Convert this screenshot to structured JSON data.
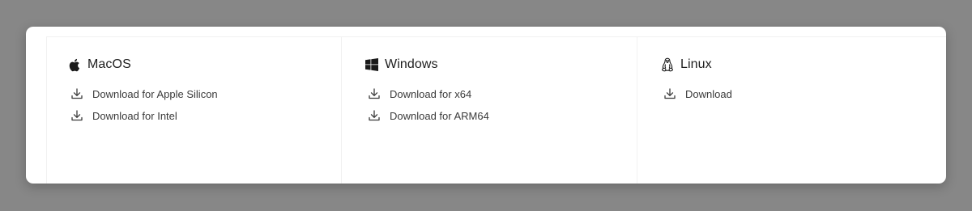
{
  "platforms": [
    {
      "name": "MacOS",
      "icon": "apple-logo-icon",
      "links": [
        {
          "label": "Download for Apple Silicon",
          "icon": "download-icon"
        },
        {
          "label": "Download for Intel",
          "icon": "download-icon"
        }
      ]
    },
    {
      "name": "Windows",
      "icon": "windows-logo-icon",
      "links": [
        {
          "label": "Download for x64",
          "icon": "download-icon"
        },
        {
          "label": "Download for ARM64",
          "icon": "download-icon"
        }
      ]
    },
    {
      "name": "Linux",
      "icon": "linux-tux-icon",
      "links": [
        {
          "label": "Download",
          "icon": "download-icon"
        }
      ]
    }
  ],
  "colors": {
    "backdrop": "#878787",
    "card": "#ffffff",
    "text": "#1e1e1e",
    "link_text": "#3a3a3a"
  }
}
